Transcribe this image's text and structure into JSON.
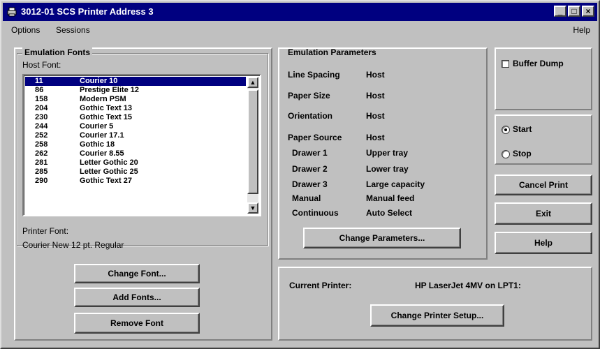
{
  "window": {
    "title": "3012-01 SCS Printer Address 3"
  },
  "titlebar_buttons": {
    "minimize": "_",
    "maximize": "□",
    "close": "×"
  },
  "menu": {
    "options": "Options",
    "sessions": "Sessions",
    "help": "Help"
  },
  "fonts_group": {
    "title": "Emulation Fonts",
    "host_font_label": "Host Font:",
    "items": [
      {
        "num": "11",
        "name": "Courier 10",
        "selected": true
      },
      {
        "num": "86",
        "name": "Prestige Elite 12"
      },
      {
        "num": "158",
        "name": "Modern PSM"
      },
      {
        "num": "204",
        "name": "Gothic Text 13"
      },
      {
        "num": "230",
        "name": "Gothic Text 15"
      },
      {
        "num": "244",
        "name": "Courier 5"
      },
      {
        "num": "252",
        "name": "Courier 17.1"
      },
      {
        "num": "258",
        "name": "Gothic 18"
      },
      {
        "num": "262",
        "name": "Courier 8.55"
      },
      {
        "num": "281",
        "name": "Letter Gothic 20"
      },
      {
        "num": "285",
        "name": "Letter Gothic 25"
      },
      {
        "num": "290",
        "name": "Gothic Text 27"
      }
    ],
    "printer_font_label": "Printer Font:",
    "printer_font_value": "Courier New 12 pt. Regular",
    "change_font": "Change Font...",
    "add_fonts": "Add Fonts...",
    "remove_font": "Remove Font"
  },
  "params_group": {
    "title": "Emulation Parameters",
    "line_spacing": {
      "label": "Line Spacing",
      "value": "Host"
    },
    "paper_size": {
      "label": "Paper Size",
      "value": "Host"
    },
    "orientation": {
      "label": "Orientation",
      "value": "Host"
    },
    "paper_source": {
      "label": "Paper Source",
      "value": "Host"
    },
    "sources": [
      {
        "label": "Drawer 1",
        "value": "Upper tray"
      },
      {
        "label": "Drawer 2",
        "value": "Lower tray"
      },
      {
        "label": "Drawer 3",
        "value": "Large capacity"
      },
      {
        "label": "Manual",
        "value": "Manual feed"
      },
      {
        "label": "Continuous",
        "value": "Auto Select"
      }
    ],
    "change_parameters": "Change Parameters..."
  },
  "right_panel": {
    "buffer_dump": "Buffer Dump",
    "start": "Start",
    "stop": "Stop",
    "start_selected": true,
    "cancel_print": "Cancel Print",
    "exit": "Exit",
    "help": "Help"
  },
  "printer_group": {
    "current_label": "Current Printer:",
    "current_value": "HP LaserJet 4MV on LPT1:",
    "change_setup": "Change Printer Setup..."
  }
}
